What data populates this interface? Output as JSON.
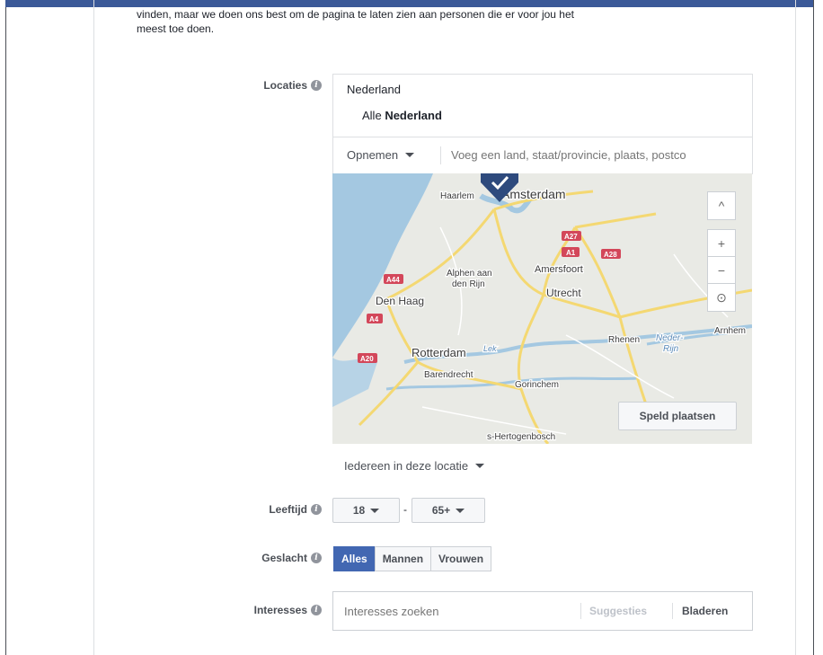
{
  "intro": {
    "line1": "vinden, maar we doen ons best om de pagina te laten zien aan personen die er voor jou het",
    "line2": "meest toe doen."
  },
  "labels": {
    "locaties": "Locaties",
    "leeftijd": "Leeftijd",
    "geslacht": "Geslacht",
    "interesses": "Interesses",
    "info_glyph": "i"
  },
  "locations": {
    "country": "Nederland",
    "all_prefix": "Alle",
    "all_bold": "Nederland",
    "include_dropdown": "Opnemen",
    "search_placeholder": "Voeg een land, staat/provincie, plaats, postco"
  },
  "map": {
    "cities": [
      "Haarlem",
      "Amsterdam",
      "Alphen aan",
      "den Rijn",
      "Amersfoort",
      "Den Haag",
      "Utrecht",
      "Rotterdam",
      "Lek",
      "Rhenen",
      "Neder-",
      "Rijn",
      "Arnhem",
      "Barendrecht",
      "Gorinchem",
      "s-Hertogenbosch"
    ],
    "roads": [
      "A27",
      "A1",
      "A28",
      "A44",
      "A4",
      "A20"
    ],
    "controls": {
      "up": "^",
      "zoom_in": "+",
      "zoom_out": "−",
      "locate": "⊙"
    },
    "pin_button": "Speld plaatsen",
    "colors": {
      "water": "#a4c8e1",
      "land": "#e9eae5",
      "highway": "#f4d872",
      "road_label": "#d3475a",
      "pin": "#2e4a7d"
    }
  },
  "audience": {
    "who": "Iedereen in deze locatie"
  },
  "age": {
    "min": "18",
    "max": "65+",
    "separator": "-"
  },
  "gender": {
    "options": [
      "Alles",
      "Mannen",
      "Vrouwen"
    ],
    "selected": "Alles"
  },
  "interests": {
    "placeholder": "Interesses zoeken",
    "suggestions": "Suggesties",
    "browse": "Bladeren"
  }
}
